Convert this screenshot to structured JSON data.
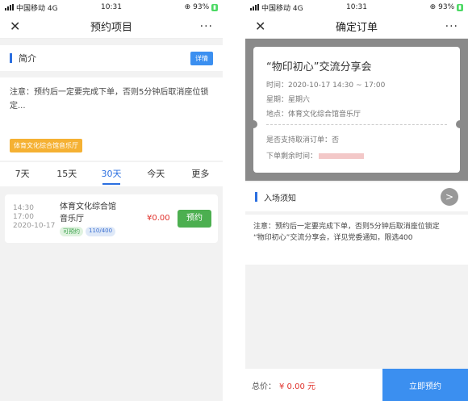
{
  "left": {
    "status": {
      "carrier": "中国移动 4G",
      "time": "10:31",
      "battery": "93%"
    },
    "nav": {
      "close": "✕",
      "title": "预约项目",
      "more": "···"
    },
    "intro": {
      "label": "简介",
      "detail_button": "详情"
    },
    "notice": "注意：预约后一定要完成下单，否则5分钟后取消座位锁定...",
    "venue_tag": "体育文化综合馆音乐厅",
    "tabs": [
      "7天",
      "15天",
      "30天",
      "今天",
      "更多"
    ],
    "active_tab": "30天",
    "slot": {
      "start": "14:30",
      "end": "17:00",
      "date": "2020-10-17",
      "venue": "体育文化综合馆音乐厅",
      "chip_status": "可预约",
      "chip_capacity": "110/400",
      "price": "¥0.00",
      "reserve_button": "预约"
    }
  },
  "right": {
    "status": {
      "carrier": "中国移动 4G",
      "time": "10:31",
      "battery": "93%"
    },
    "nav": {
      "close": "✕",
      "title": "确定订单",
      "more": "···"
    },
    "ticket": {
      "event": "“物印初心”交流分享会",
      "time_line": "时间：2020-10-17 14:30 ~ 17:00",
      "weekday_line": "星期：星期六",
      "place_line": "地点：体育文化综合馆音乐厅",
      "cancel_line": "是否支持取消订单：否",
      "remain_label": "下单剩余时间："
    },
    "entry": {
      "label": "入场须知",
      "arrow": ">",
      "text1": "注意：预约后一定要完成下单，否则5分钟后取消座位锁定",
      "text2": "“物印初心”交流分享会，详见党委通知，限选400"
    },
    "footer": {
      "total_label": "总价：",
      "total_value": "¥ 0.00 元",
      "submit": "立即预约"
    }
  }
}
